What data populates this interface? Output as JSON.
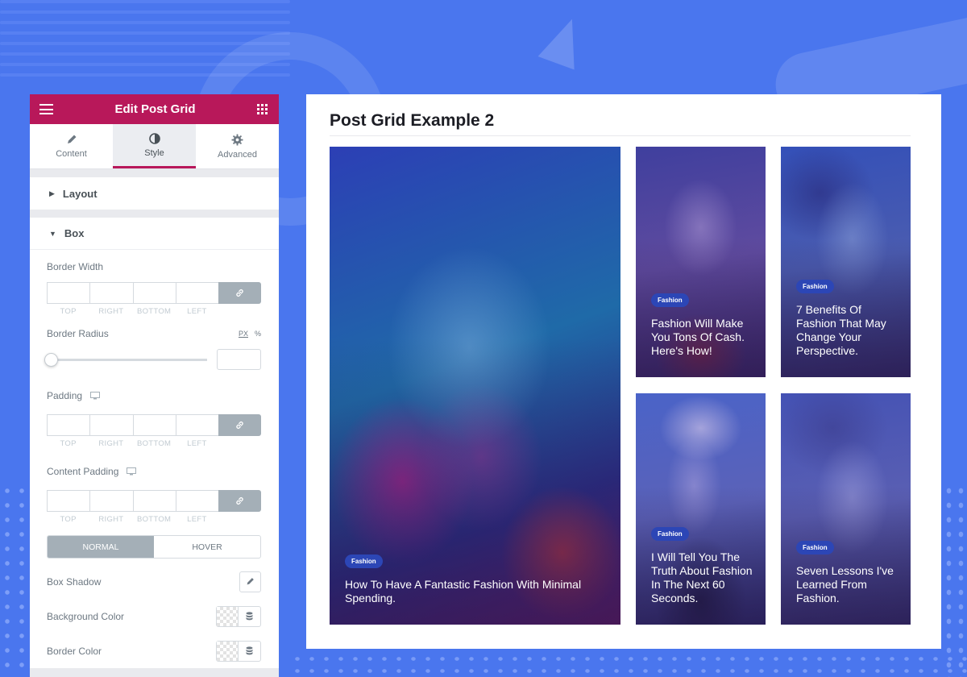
{
  "panel": {
    "title": "Edit Post Grid",
    "tabs": [
      {
        "label": "Content",
        "icon": "pencil-icon"
      },
      {
        "label": "Style",
        "icon": "half-circle-icon"
      },
      {
        "label": "Advanced",
        "icon": "gear-icon"
      }
    ],
    "active_tab": "Style",
    "sections": {
      "layout": {
        "label": "Layout",
        "expanded": false
      },
      "box": {
        "label": "Box",
        "expanded": true
      }
    },
    "controls": {
      "border_width": {
        "label": "Border Width",
        "sides": [
          "TOP",
          "RIGHT",
          "BOTTOM",
          "LEFT"
        ]
      },
      "border_radius": {
        "label": "Border Radius",
        "unit_px": "PX",
        "unit_pct": "%",
        "value": ""
      },
      "padding": {
        "label": "Padding",
        "sides": [
          "TOP",
          "RIGHT",
          "BOTTOM",
          "LEFT"
        ]
      },
      "content_padding": {
        "label": "Content Padding",
        "sides": [
          "TOP",
          "RIGHT",
          "BOTTOM",
          "LEFT"
        ]
      },
      "state_normal": "NORMAL",
      "state_hover": "HOVER",
      "box_shadow": "Box Shadow",
      "background_color": "Background Color",
      "border_color": "Border Color"
    }
  },
  "preview": {
    "title": "Post Grid Example 2",
    "posts": [
      {
        "category": "Fashion",
        "title": "How To Have A Fantastic Fashion With Minimal Spending."
      },
      {
        "category": "Fashion",
        "title": "Fashion Will Make You Tons Of Cash. Here's How!"
      },
      {
        "category": "Fashion",
        "title": "7 Benefits Of Fashion That May Change Your Perspective."
      },
      {
        "category": "Fashion",
        "title": "I Will Tell You The Truth About Fashion In The Next 60 Seconds."
      },
      {
        "category": "Fashion",
        "title": "Seven Lessons I've Learned From Fashion."
      }
    ]
  },
  "colors": {
    "background": "#4a76ee",
    "header": "#b8185a",
    "badge": "#2c46b6",
    "active_tab_underline": "#b8185a"
  }
}
